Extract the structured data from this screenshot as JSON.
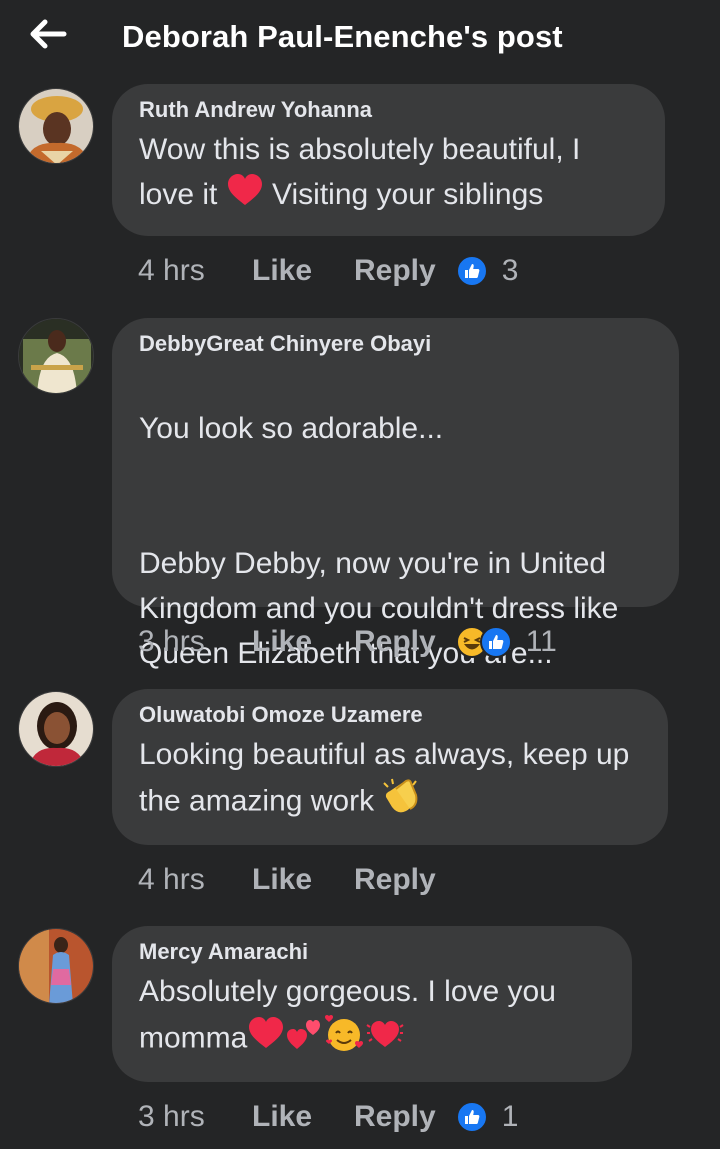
{
  "header": {
    "title": "Deborah Paul-Enenche's post",
    "back_icon": "arrow-left-icon"
  },
  "colors": {
    "background": "#242526",
    "bubble": "#3a3b3c",
    "text": "#e4e6eb",
    "muted": "#b0b3b8",
    "like_blue": "#1877f2",
    "heart_red": "#f02849"
  },
  "comments": [
    {
      "author": "Ruth Andrew Yohanna",
      "text_before": "Wow this is absolutely beautiful, I love it ",
      "text_emoji": "red-heart-icon",
      "text_after": " Visiting your siblings",
      "time": "4 hrs",
      "like_label": "Like",
      "reply_label": "Reply",
      "reactions": [
        "like-reaction-icon"
      ],
      "reaction_count": "3"
    },
    {
      "author": "DebbyGreat Chinyere Obayi",
      "text_line1": "You look so adorable...",
      "text_line2": "Debby Debby, now you're in United Kingdom and you couldn't dress like Queen Elizabeth that you are...",
      "time": "3 hrs",
      "like_label": "Like",
      "reply_label": "Reply",
      "reactions": [
        "haha-reaction-icon",
        "like-reaction-icon"
      ],
      "reaction_count": "11"
    },
    {
      "author": "Oluwatobi Omoze Uzamere",
      "text_before": "Looking beautiful as always, keep up the amazing work ",
      "text_emoji": "clapping-hands-icon",
      "time": "4 hrs",
      "like_label": "Like",
      "reply_label": "Reply"
    },
    {
      "author": "Mercy Amarachi",
      "text_before": "Absolutely gorgeous. I love you momma",
      "text_emojis": [
        "red-heart-icon",
        "two-hearts-icon",
        "smiling-face-with-hearts-icon",
        "beating-heart-icon"
      ],
      "time": "3 hrs",
      "like_label": "Like",
      "reply_label": "Reply",
      "reactions": [
        "like-reaction-icon"
      ],
      "reaction_count": "1"
    }
  ]
}
